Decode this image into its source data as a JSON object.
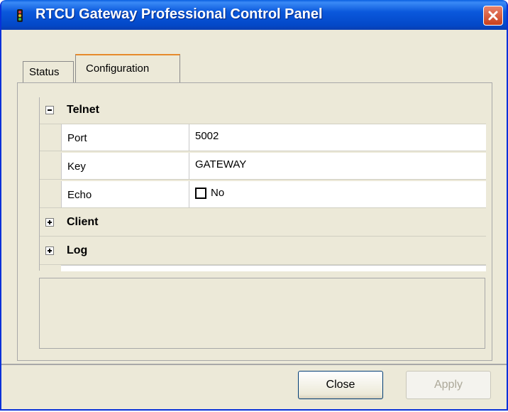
{
  "window": {
    "title": "RTCU Gateway Professional Control Panel"
  },
  "tabs": [
    {
      "label": "Status",
      "selected": false
    },
    {
      "label": "Configuration",
      "selected": true
    }
  ],
  "property_grid": {
    "categories": [
      {
        "label": "Telnet",
        "expanded": true,
        "properties": [
          {
            "name": "Port",
            "value": "5002"
          },
          {
            "name": "Key",
            "value": "GATEWAY"
          },
          {
            "name": "Echo",
            "value": "No",
            "checked": false
          }
        ]
      },
      {
        "label": "Client",
        "expanded": false
      },
      {
        "label": "Log",
        "expanded": false
      }
    ]
  },
  "buttons": {
    "close": "Close",
    "apply": "Apply"
  },
  "colors": {
    "titlebar": "#0a58dc",
    "window_bg": "#ece9d8",
    "close_button": "#c9401c",
    "active_tab_accent": "#e68b2c"
  }
}
